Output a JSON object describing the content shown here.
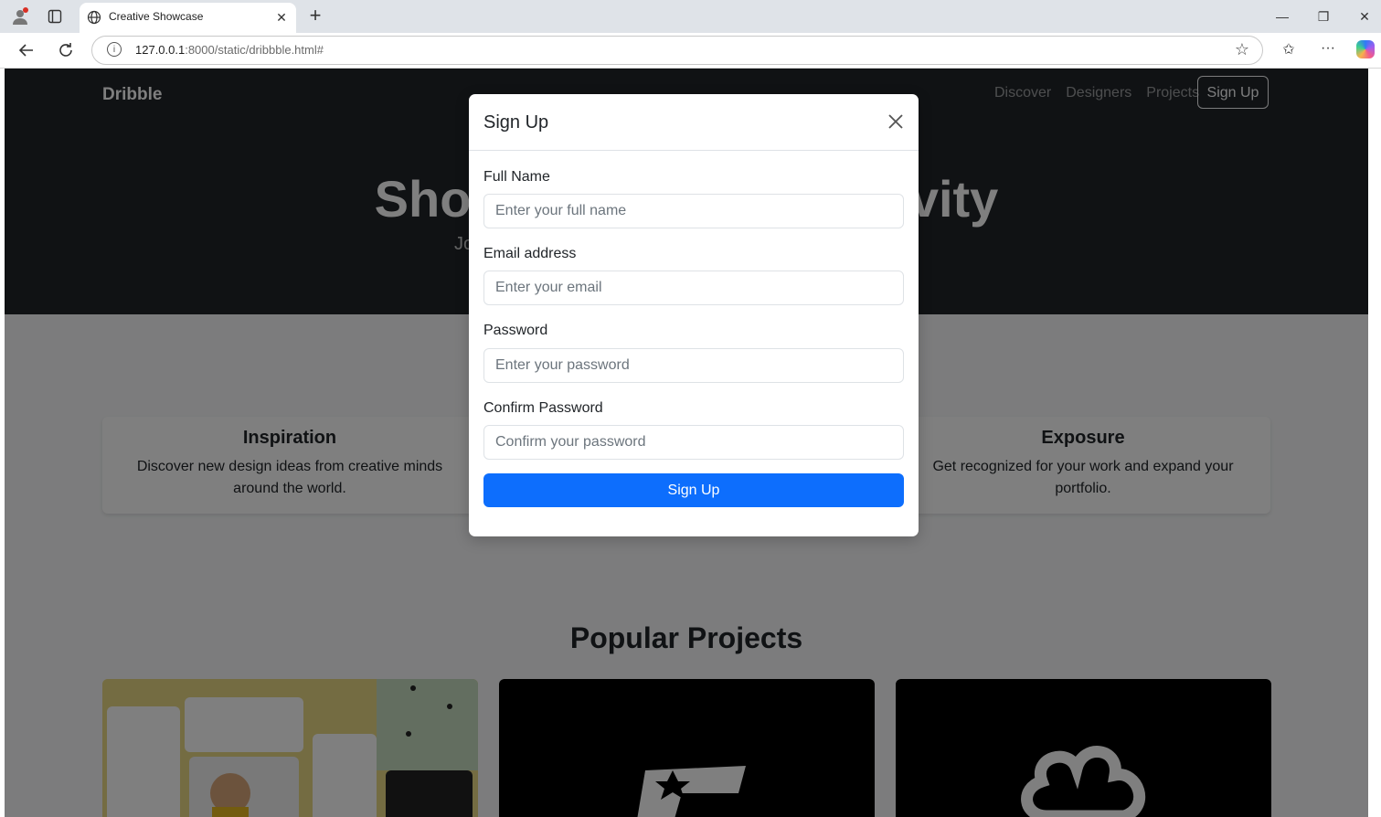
{
  "browser": {
    "tab_title": "Creative Showcase",
    "url_host": "127.0.0.1",
    "url_rest": ":8000/static/dribbble.html#"
  },
  "navbar": {
    "brand": "Dribble",
    "links": [
      "Discover",
      "Designers",
      "Projects"
    ],
    "signup": "Sign Up"
  },
  "hero": {
    "title": "Showcase Your Creativity",
    "subtitle": "Join our community of designers and share your projects."
  },
  "features": [
    {
      "title": "Inspiration",
      "text": "Discover new design ideas from creative minds around the world."
    },
    {
      "title": "Exposure",
      "text": "Get recognized for your work and expand your portfolio."
    }
  ],
  "popular": {
    "title": "Popular Projects"
  },
  "modal": {
    "title": "Sign Up",
    "fields": [
      {
        "label": "Full Name",
        "placeholder": "Enter your full name"
      },
      {
        "label": "Email address",
        "placeholder": "Enter your email"
      },
      {
        "label": "Password",
        "placeholder": "Enter your password"
      },
      {
        "label": "Confirm Password",
        "placeholder": "Confirm your password"
      }
    ],
    "submit": "Sign Up"
  },
  "colors": {
    "primary": "#0d6efd",
    "dark": "#212529"
  }
}
